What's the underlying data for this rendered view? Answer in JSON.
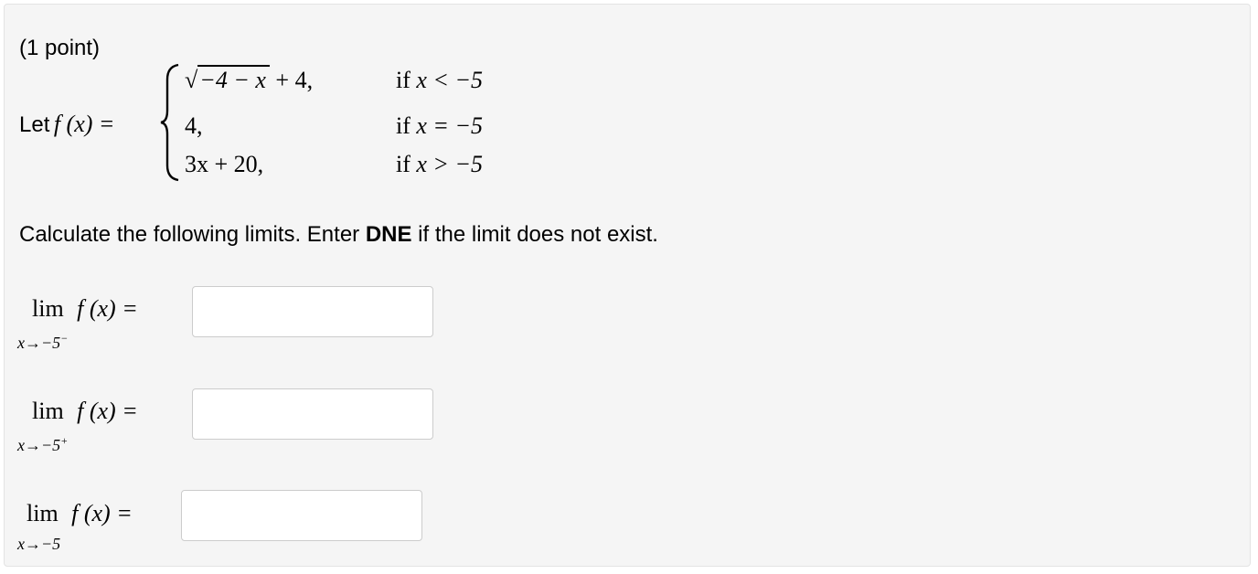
{
  "problem": {
    "points": "(1 point)",
    "let_label": "Let",
    "fx": "f (x) =",
    "pieces": [
      {
        "expr_sqrt_symbol": "√",
        "expr_radicand": "−4 − x",
        "expr_tail": "+ 4,",
        "cond_if": "if",
        "cond": "x < −5"
      },
      {
        "expr": "4,",
        "cond_if": "if",
        "cond": "x = −5"
      },
      {
        "expr": "3x + 20,",
        "cond_if": "if",
        "cond": "x > −5"
      }
    ]
  },
  "instructions": {
    "before": "Calculate the following limits. Enter ",
    "bold": "DNE",
    "after": " if the limit does not exist."
  },
  "limits": [
    {
      "lim": "lim",
      "fx": "f (x) =",
      "sub_base": "x→−5",
      "sub_sup": "−",
      "value": ""
    },
    {
      "lim": "lim",
      "fx": "f (x) =",
      "sub_base": "x→−5",
      "sub_sup": "+",
      "value": ""
    },
    {
      "lim": "lim",
      "fx": "f (x) =",
      "sub_base": "x→−5",
      "sub_sup": "",
      "value": ""
    }
  ]
}
